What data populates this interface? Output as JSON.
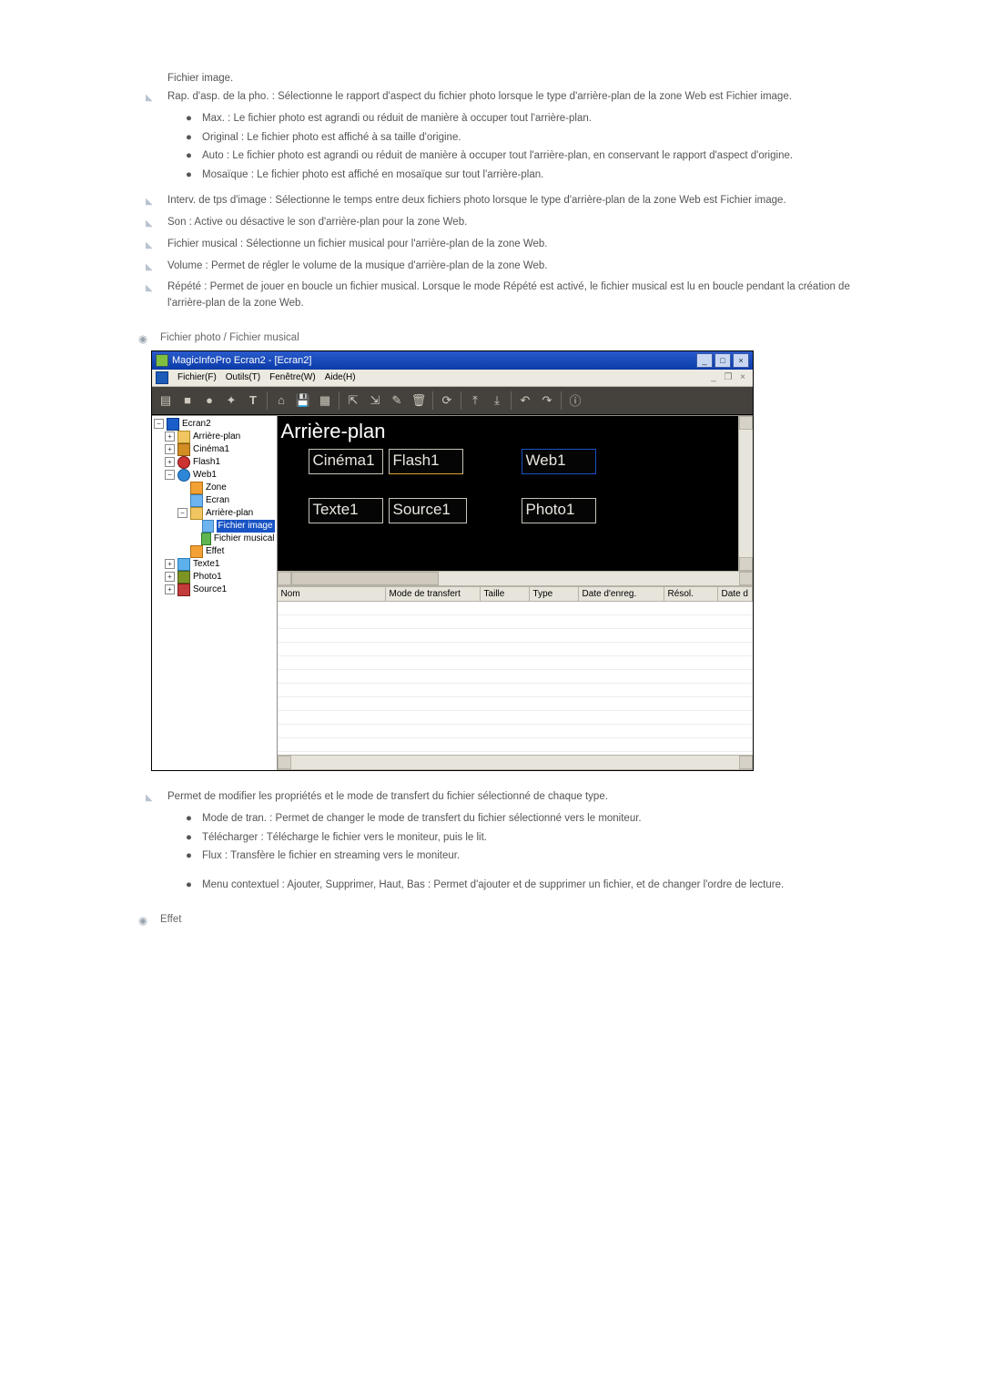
{
  "intro": "Fichier image.",
  "items_top": [
    {
      "text": "Rap. d'asp. de la pho. : Sélectionne le rapport d'aspect du fichier photo lorsque le type d'arrière-plan de la zone Web est Fichier image.",
      "sub": [
        "Max. : Le fichier photo est agrandi ou réduit de manière à occuper tout l'arrière-plan.",
        "Original : Le fichier photo est affiché à sa taille d'origine.",
        "Auto : Le fichier photo est agrandi ou réduit de manière à occuper tout l'arrière-plan, en conservant le rapport d'aspect d'origine.",
        "Mosaïque : Le fichier photo est affiché en mosaïque sur tout l'arrière-plan."
      ]
    },
    {
      "text": "Interv. de tps d'image : Sélectionne le temps entre deux fichiers photo lorsque le type d'arrière-plan de la zone Web est Fichier image."
    },
    {
      "text": "Son : Active ou désactive le son d'arrière-plan pour la zone Web."
    },
    {
      "text": "Fichier musical : Sélectionne un fichier musical pour l'arrière-plan de la zone Web."
    },
    {
      "text": "Volume : Permet de régler le volume de la musique d'arrière-plan de la zone Web."
    },
    {
      "text": "Répété : Permet de jouer en boucle un fichier musical. Lorsque le mode Répété est activé, le fichier musical est lu en boucle pendant la création de l'arrière-plan de la zone Web."
    }
  ],
  "section_photo_title": "Fichier photo / Fichier musical",
  "app": {
    "title": "MagicInfoPro Ecran2 - [Ecran2]",
    "menus": [
      "Fichier(F)",
      "Outils(T)",
      "Fenêtre(W)",
      "Aide(H)"
    ],
    "canvas_title": "Arrière-plan",
    "zones": {
      "cinema": "Cinéma1",
      "flash": "Flash1",
      "web": "Web1",
      "texte": "Texte1",
      "source": "Source1",
      "photo": "Photo1"
    },
    "grid_cols": [
      "Nom",
      "Mode de transfert",
      "Taille",
      "Type",
      "Date d'enreg.",
      "Résol.",
      "Date d"
    ],
    "tree": {
      "root": "Ecran2",
      "arriere": "Arrière-plan",
      "cinema": "Cinéma1",
      "flash": "Flash1",
      "web": "Web1",
      "zone": "Zone",
      "ecran": "Ecran",
      "arriere2": "Arrière-plan",
      "fimage": "Fichier image",
      "fmusical": "Fichier musical",
      "effet": "Effet",
      "texte": "Texte1",
      "photo": "Photo1",
      "source": "Source1"
    }
  },
  "items_bottom": [
    {
      "text": "Permet de modifier les propriétés et le mode de transfert du fichier sélectionné de chaque type.",
      "sub1": [
        "Mode de tran. : Permet de changer le mode de transfert du fichier sélectionné vers le moniteur.",
        "Télécharger : Télécharge le fichier vers le moniteur, puis le lit.",
        "Flux : Transfère le fichier en streaming vers le moniteur."
      ],
      "sub2": [
        "Menu contextuel : Ajouter, Supprimer, Haut, Bas : Permet d'ajouter et de supprimer un fichier, et de changer l'ordre de lecture."
      ]
    }
  ],
  "section_effet_title": "Effet"
}
